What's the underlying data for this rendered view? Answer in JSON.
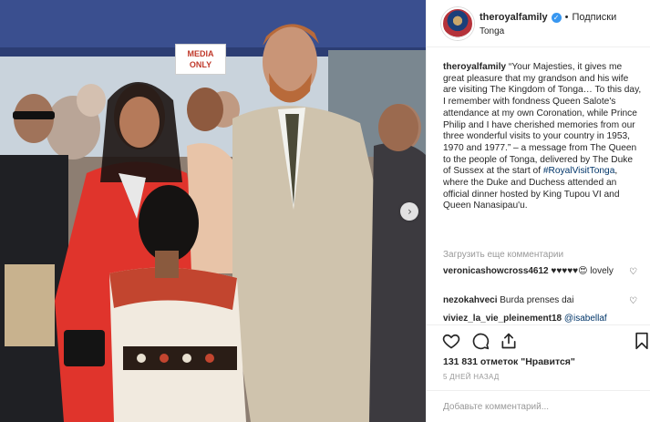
{
  "photo": {
    "sign_text_line1": "MEDIA",
    "sign_text_line2": "ONLY",
    "next_arrow": "chevron-right-icon"
  },
  "post": {
    "username": "theroyalfamily",
    "follow_label": "Подписки",
    "separator": "•",
    "location": "Tonga",
    "caption_text": "“Your Majesties, it gives me great pleasure that my grandson and his wife are visiting The Kingdom of Tonga… To this day, I remember with fondness Queen Salote's attendance at my own Coronation, while Prince Philip and I have cherished memories from our three wonderful visits to your country in 1953, 1970 and 1977.” – a message from The Queen to the people of Tonga, delivered by The Duke of Sussex at the start of ",
    "caption_hashtag": "#RoyalVisitTonga",
    "caption_tail": ", where the Duke and Duchess attended an official dinner hosted by King Tupou VI and Queen Nanasipau'u.",
    "load_more": "Загрузить еще комментарии"
  },
  "comments": [
    {
      "user": "veronicashowcross4612",
      "text": "♥♥♥♥♥😍 lovely"
    },
    {
      "user": "nezokahveci",
      "text": "Burda prenses dai"
    },
    {
      "user": "viviez_la_vie_pleinement18",
      "text": "",
      "mention": "@isabellaf"
    }
  ],
  "actions": {
    "like_icon": "heart-icon",
    "comment_icon": "comment-icon",
    "share_icon": "share-icon",
    "save_icon": "bookmark-icon"
  },
  "likes_text": "131 831 отметок \"Нравится\"",
  "timestamp": "5 ДНЕЙ НАЗАД",
  "add_comment_placeholder": "Добавьте комментарий...",
  "colors": {
    "verified": "#3897f0",
    "link": "#003569",
    "muted": "#999999",
    "border": "#efefef"
  }
}
